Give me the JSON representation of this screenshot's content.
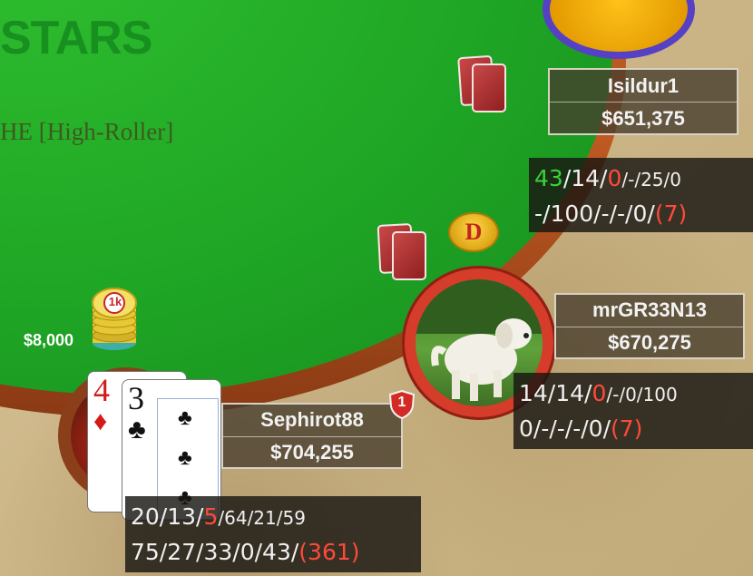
{
  "table": {
    "logo_text": "STARS",
    "game_text": "HE [High-Roller]"
  },
  "players": [
    {
      "id": "isildur",
      "name": "Isildur1",
      "stack": "$651,375",
      "hud_line1": [
        "43",
        "/14/",
        "0",
        "/-/25/0"
      ],
      "hud_line2": [
        "-/100/-/-/0/",
        "(7)"
      ]
    },
    {
      "id": "mrgr",
      "name": "mrGR33N13",
      "stack": "$670,275",
      "hud_line1": [
        "14/14/",
        "0",
        "/-/0/100"
      ],
      "hud_line2": [
        "0/-/-/-/0/",
        "(7)"
      ]
    },
    {
      "id": "hero",
      "name": "Sephirot88",
      "stack": "$704,255",
      "hud_line1": [
        "20/13/",
        "5",
        "/64/21/59"
      ],
      "hud_line2": [
        "75/27/33/0/43/",
        "(361)"
      ],
      "bet": "$8,000",
      "chip_label": "1k",
      "cards": [
        {
          "rank": "4",
          "suit": "♦"
        },
        {
          "rank": "3",
          "suit": "♣"
        },
        {
          "rank": "",
          "suit": "♣"
        }
      ],
      "badge_text": "1"
    }
  ],
  "dealer_button": "D",
  "colors": {
    "felt": "#1fa625",
    "rail": "#c05a22",
    "hud_green": "#39d33a",
    "hud_red": "#ff4a3a",
    "player_ring": "#d63c2a",
    "orb_ring": "#5640c4"
  },
  "icons": [
    "card-back-icon",
    "dealer-button-icon",
    "chip-stack-icon",
    "shield-badge-icon",
    "club-icon",
    "diamond-icon"
  ]
}
